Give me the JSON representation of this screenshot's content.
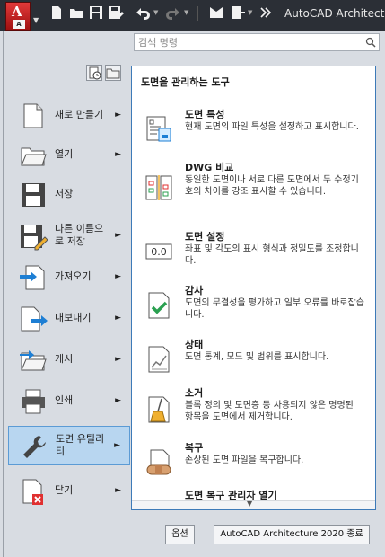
{
  "title_bar": {
    "app_title": "AutoCAD Architectur",
    "logo_letter": "A",
    "logo_sub": "A",
    "quick_access": [
      "new-icon",
      "open-icon",
      "save-icon",
      "save-as-icon",
      "undo-icon",
      "redo-icon",
      "workspace-icon",
      "sheet-icon",
      "chevron-icon"
    ]
  },
  "search": {
    "placeholder": "검색 명령"
  },
  "left_menu": {
    "items": [
      {
        "label": "새로 만들기",
        "has_submenu": true
      },
      {
        "label": "열기",
        "has_submenu": true
      },
      {
        "label": "저장",
        "has_submenu": false
      },
      {
        "label": "다른 이름으로 저장",
        "has_submenu": true
      },
      {
        "label": "가져오기",
        "has_submenu": true
      },
      {
        "label": "내보내기",
        "has_submenu": true
      },
      {
        "label": "게시",
        "has_submenu": true
      },
      {
        "label": "인쇄",
        "has_submenu": true
      },
      {
        "label": "도면 유틸리티",
        "has_submenu": true,
        "active": true
      },
      {
        "label": "닫기",
        "has_submenu": true
      }
    ]
  },
  "panel": {
    "header": "도면을 관리하는 도구",
    "tools": [
      {
        "title": "도면 특성",
        "desc": "현재 도면의 파일 특성을 설정하고 표시합니다."
      },
      {
        "title": "DWG 비교",
        "desc": "동일한 도면이나 서로 다른 도면에서 두 수정기호의 차이를 강조 표시할 수 있습니다."
      },
      {
        "title": "도면 설정",
        "desc": "좌표 및 각도의 표시 형식과 정밀도를 조정합니다.",
        "icon_text": "0.0"
      },
      {
        "title": "감사",
        "desc": "도면의 무결성을 평가하고 일부 오류를 바로잡습니다."
      },
      {
        "title": "상태",
        "desc": "도면 통계, 모드 및 범위를 표시합니다."
      },
      {
        "title": "소거",
        "desc": "블록 정의 및 도면층 등 사용되지 않은 명명된 항목을 도면에서 제거합니다."
      },
      {
        "title": "복구",
        "desc": "손상된 도면 파일을 복구합니다."
      },
      {
        "title": "도면 복구 관리자 열기",
        "desc": ""
      }
    ]
  },
  "buttons": {
    "options": "옵션",
    "exit": "AutoCAD Architecture 2020 종료"
  },
  "colors": {
    "active_bg": "#b8d6f0",
    "panel_border": "#3d7ab8",
    "titlebar": "#2b2f36"
  }
}
